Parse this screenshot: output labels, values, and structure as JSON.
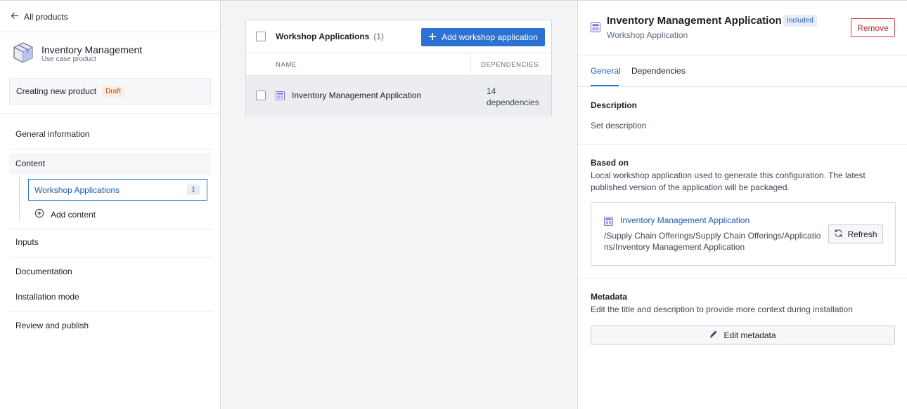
{
  "sidebar": {
    "back_label": "All products",
    "product_name": "Inventory Management",
    "product_subtitle": "Use case product",
    "status_text": "Creating new product",
    "status_tag": "Draft",
    "nav": {
      "general_information": "General information",
      "content": "Content",
      "workshop_applications": "Workshop Applications",
      "workshop_applications_count": "1",
      "add_content": "Add content",
      "inputs": "Inputs",
      "documentation": "Documentation",
      "installation_mode": "Installation mode",
      "review_and_publish": "Review and publish"
    }
  },
  "middle": {
    "card_title": "Workshop Applications",
    "card_count": "(1)",
    "add_button": "Add workshop application",
    "columns": [
      "NAME",
      "DEPENDENCIES"
    ],
    "rows": [
      {
        "name": "Inventory Management Application",
        "deps_line1": "14",
        "deps_line2": "dependencies"
      }
    ]
  },
  "detail": {
    "title": "Inventory Management Application",
    "badge": "Included",
    "subtitle": "Workshop Application",
    "remove_button": "Remove",
    "tabs": [
      "General",
      "Dependencies"
    ],
    "active_tab": "General",
    "description_title": "Description",
    "description_value": "Set description",
    "based_on_title": "Based on",
    "based_on_text": "Local workshop application used to generate this configuration. The latest published version of the application will be packaged.",
    "source_name": "Inventory Management Application",
    "source_path": "/Supply Chain Offerings/Supply Chain Offerings/Applications/Inventory Management Application",
    "refresh_button": "Refresh",
    "metadata_title": "Metadata",
    "metadata_text": "Edit the title and description to provide more context during installation",
    "edit_button": "Edit metadata"
  },
  "colors": {
    "primary": "#2d72d2",
    "link": "#215db0",
    "danger": "#cd4246",
    "draft_bg": "#fbecdd",
    "app_icon": "#7961db"
  }
}
